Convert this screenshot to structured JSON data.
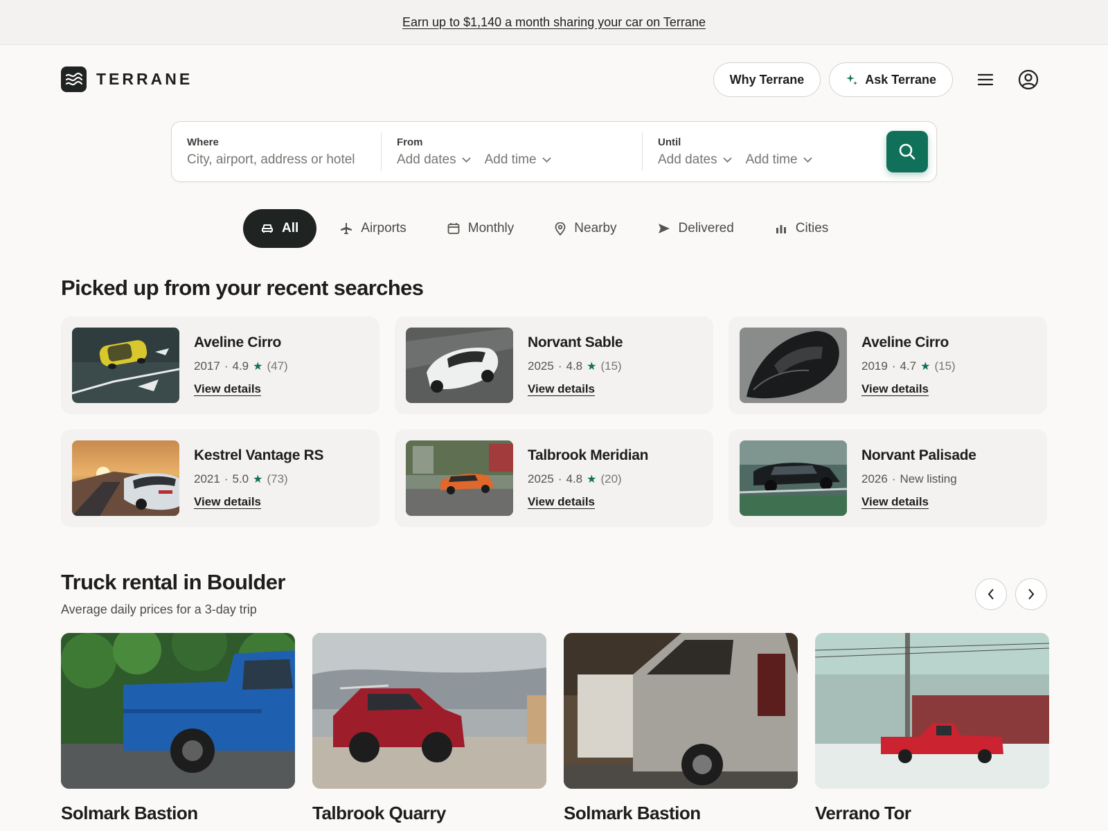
{
  "promo": {
    "text": "Earn up to $1,140 a month sharing your car on Terrane"
  },
  "brand": {
    "name": "TERRANE"
  },
  "header": {
    "why_label": "Why Terrane",
    "ask_label": "Ask Terrane"
  },
  "search": {
    "where_label": "Where",
    "where_placeholder": "City, airport, address or hotel",
    "from_label": "From",
    "until_label": "Until",
    "dates_placeholder": "Add dates",
    "time_placeholder": "Add time"
  },
  "tabs": [
    "All",
    "Airports",
    "Monthly",
    "Nearby",
    "Delivered",
    "Cities"
  ],
  "recent": {
    "title": "Picked up from your recent searches",
    "link_label": "View details",
    "items": [
      {
        "name": "Aveline Cirro",
        "year": "2017",
        "rating": "4.9",
        "count": "(47)"
      },
      {
        "name": "Norvant Sable",
        "year": "2025",
        "rating": "4.8",
        "count": "(15)"
      },
      {
        "name": "Aveline Cirro",
        "year": "2019",
        "rating": "4.7",
        "count": "(15)"
      },
      {
        "name": "Kestrel Vantage RS",
        "year": "2021",
        "rating": "5.0",
        "count": "(73)"
      },
      {
        "name": "Talbrook Meridian",
        "year": "2025",
        "rating": "4.8",
        "count": "(20)"
      },
      {
        "name": "Norvant Palisade",
        "year": "2026",
        "status": "New listing"
      }
    ]
  },
  "trucks": {
    "title": "Truck rental in Boulder",
    "subtitle": "Average daily prices for a 3-day trip",
    "items": [
      {
        "name": "Solmark Bastion"
      },
      {
        "name": "Talbrook Quarry"
      },
      {
        "name": "Solmark Bastion"
      },
      {
        "name": "Verrano Tor"
      }
    ]
  },
  "colors": {
    "accent": "#11705a",
    "dark": "#1f2321",
    "card_bg": "#f3f2f0"
  }
}
